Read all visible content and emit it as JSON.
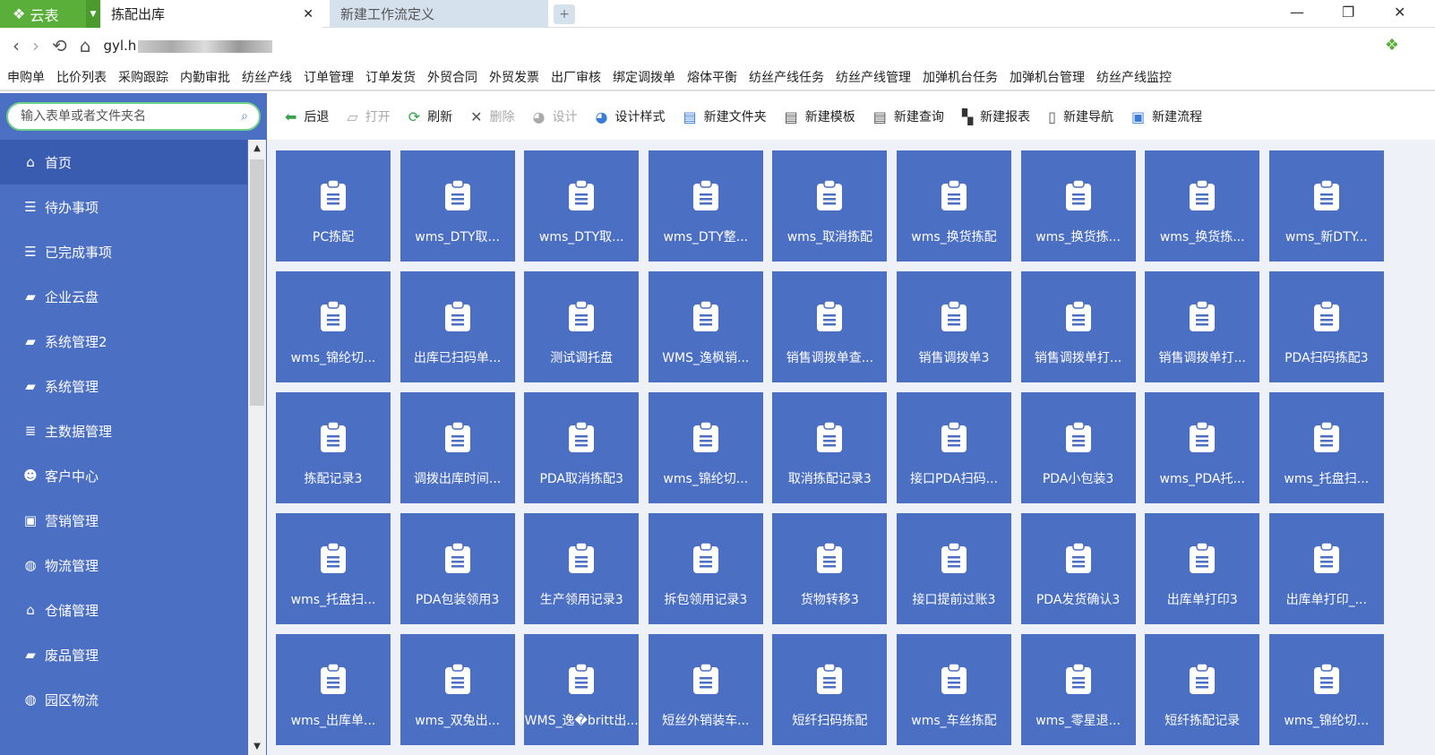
{
  "app": {
    "brand": "云表",
    "tabs": [
      {
        "label": "拣配出库",
        "active": true
      },
      {
        "label": "新建工作流定义",
        "active": false
      }
    ]
  },
  "address": {
    "url": "gyl.h"
  },
  "bookmarks": [
    "申购单",
    "比价列表",
    "采购跟踪",
    "内勤审批",
    "纺丝产线",
    "订单管理",
    "订单发货",
    "外贸合同",
    "外贸发票",
    "出厂审核",
    "绑定调拨单",
    "熔体平衡",
    "纺丝产线任务",
    "纺丝产线管理",
    "加弹机台任务",
    "加弹机台管理",
    "纺丝产线监控"
  ],
  "sidebar": {
    "search_placeholder": "输入表单或者文件夹名",
    "items": [
      {
        "label": "首页",
        "icon": "home-icon",
        "g": "⌂"
      },
      {
        "label": "待办事项",
        "icon": "list-icon",
        "g": "☰"
      },
      {
        "label": "已完成事项",
        "icon": "list-icon",
        "g": "☰"
      },
      {
        "label": "企业云盘",
        "icon": "folder-icon",
        "g": "▰"
      },
      {
        "label": "系统管理2",
        "icon": "folder-icon",
        "g": "▰"
      },
      {
        "label": "系统管理",
        "icon": "folder-icon",
        "g": "▰"
      },
      {
        "label": "主数据管理",
        "icon": "database-icon",
        "g": "≣"
      },
      {
        "label": "客户中心",
        "icon": "users-icon",
        "g": "☻"
      },
      {
        "label": "营销管理",
        "icon": "card-icon",
        "g": "▣"
      },
      {
        "label": "物流管理",
        "icon": "globe-icon",
        "g": "◍"
      },
      {
        "label": "仓储管理",
        "icon": "home-icon",
        "g": "⌂"
      },
      {
        "label": "废品管理",
        "icon": "folder-icon",
        "g": "▰"
      },
      {
        "label": "园区物流",
        "icon": "globe-icon",
        "g": "◍"
      }
    ]
  },
  "toolbar": [
    {
      "label": "后退",
      "icon": "back-arrow-icon",
      "g": "⬅",
      "disabled": false,
      "color": "#3aa04a"
    },
    {
      "label": "打开",
      "icon": "open-folder-icon",
      "g": "▱",
      "disabled": true,
      "color": "#aaa"
    },
    {
      "label": "刷新",
      "icon": "refresh-icon",
      "g": "⟳",
      "disabled": false,
      "color": "#3aa04a"
    },
    {
      "label": "删除",
      "icon": "delete-icon",
      "g": "✕",
      "disabled": true,
      "color": "#555"
    },
    {
      "label": "设计",
      "icon": "palette-icon",
      "g": "◕",
      "disabled": true,
      "color": "#aaa"
    },
    {
      "label": "设计样式",
      "icon": "palette-icon",
      "g": "◕",
      "disabled": false,
      "color": "#3a7bd5"
    },
    {
      "label": "新建文件夹",
      "icon": "new-folder-icon",
      "g": "▤",
      "disabled": false,
      "color": "#3a7bd5"
    },
    {
      "label": "新建模板",
      "icon": "template-icon",
      "g": "▤",
      "disabled": false,
      "color": "#555"
    },
    {
      "label": "新建查询",
      "icon": "query-icon",
      "g": "▤",
      "disabled": false,
      "color": "#555"
    },
    {
      "label": "新建报表",
      "icon": "report-icon",
      "g": "▚",
      "disabled": false,
      "color": "#333"
    },
    {
      "label": "新建导航",
      "icon": "navigation-icon",
      "g": "▯",
      "disabled": false,
      "color": "#555"
    },
    {
      "label": "新建流程",
      "icon": "flow-icon",
      "g": "▣",
      "disabled": false,
      "color": "#3a7bd5"
    }
  ],
  "tiles": [
    "PC拣配",
    "wms_DTY取...",
    "wms_DTY取...",
    "wms_DTY整...",
    "wms_取消拣配",
    "wms_换货拣配",
    "wms_换货拣...",
    "wms_换货拣...",
    "wms_新DTY...",
    "wms_锦纶切...",
    "出库已扫码单...",
    "测试调托盘",
    "WMS_逸枫销...",
    "销售调拨单查...",
    "销售调拨单3",
    "销售调拨单打...",
    "销售调拨单打...",
    "PDA扫码拣配3",
    "拣配记录3",
    "调拨出库时间...",
    "PDA取消拣配3",
    "wms_锦纶切...",
    "取消拣配记录3",
    "接口PDA扫码...",
    "PDA小包装3",
    "wms_PDA托...",
    "wms_托盘扫...",
    "wms_托盘扫...",
    "PDA包装领用3",
    "生产领用记录3",
    "拆包领用记录3",
    "货物转移3",
    "接口提前过账3",
    "PDA发货确认3",
    "出库单打印3",
    "出库单打印_...",
    "wms_出库单...",
    "wms_双兔出...",
    "WMS_逸�britt出...",
    "短丝外销装车...",
    "短纤扫码拣配",
    "wms_车丝拣配",
    "wms_零星退...",
    "短纤拣配记录",
    "wms_锦纶切..."
  ],
  "colors": {
    "brand": "#5aae3a",
    "sidebar": "#4b6fc2",
    "tile": "#4b6fc2"
  }
}
